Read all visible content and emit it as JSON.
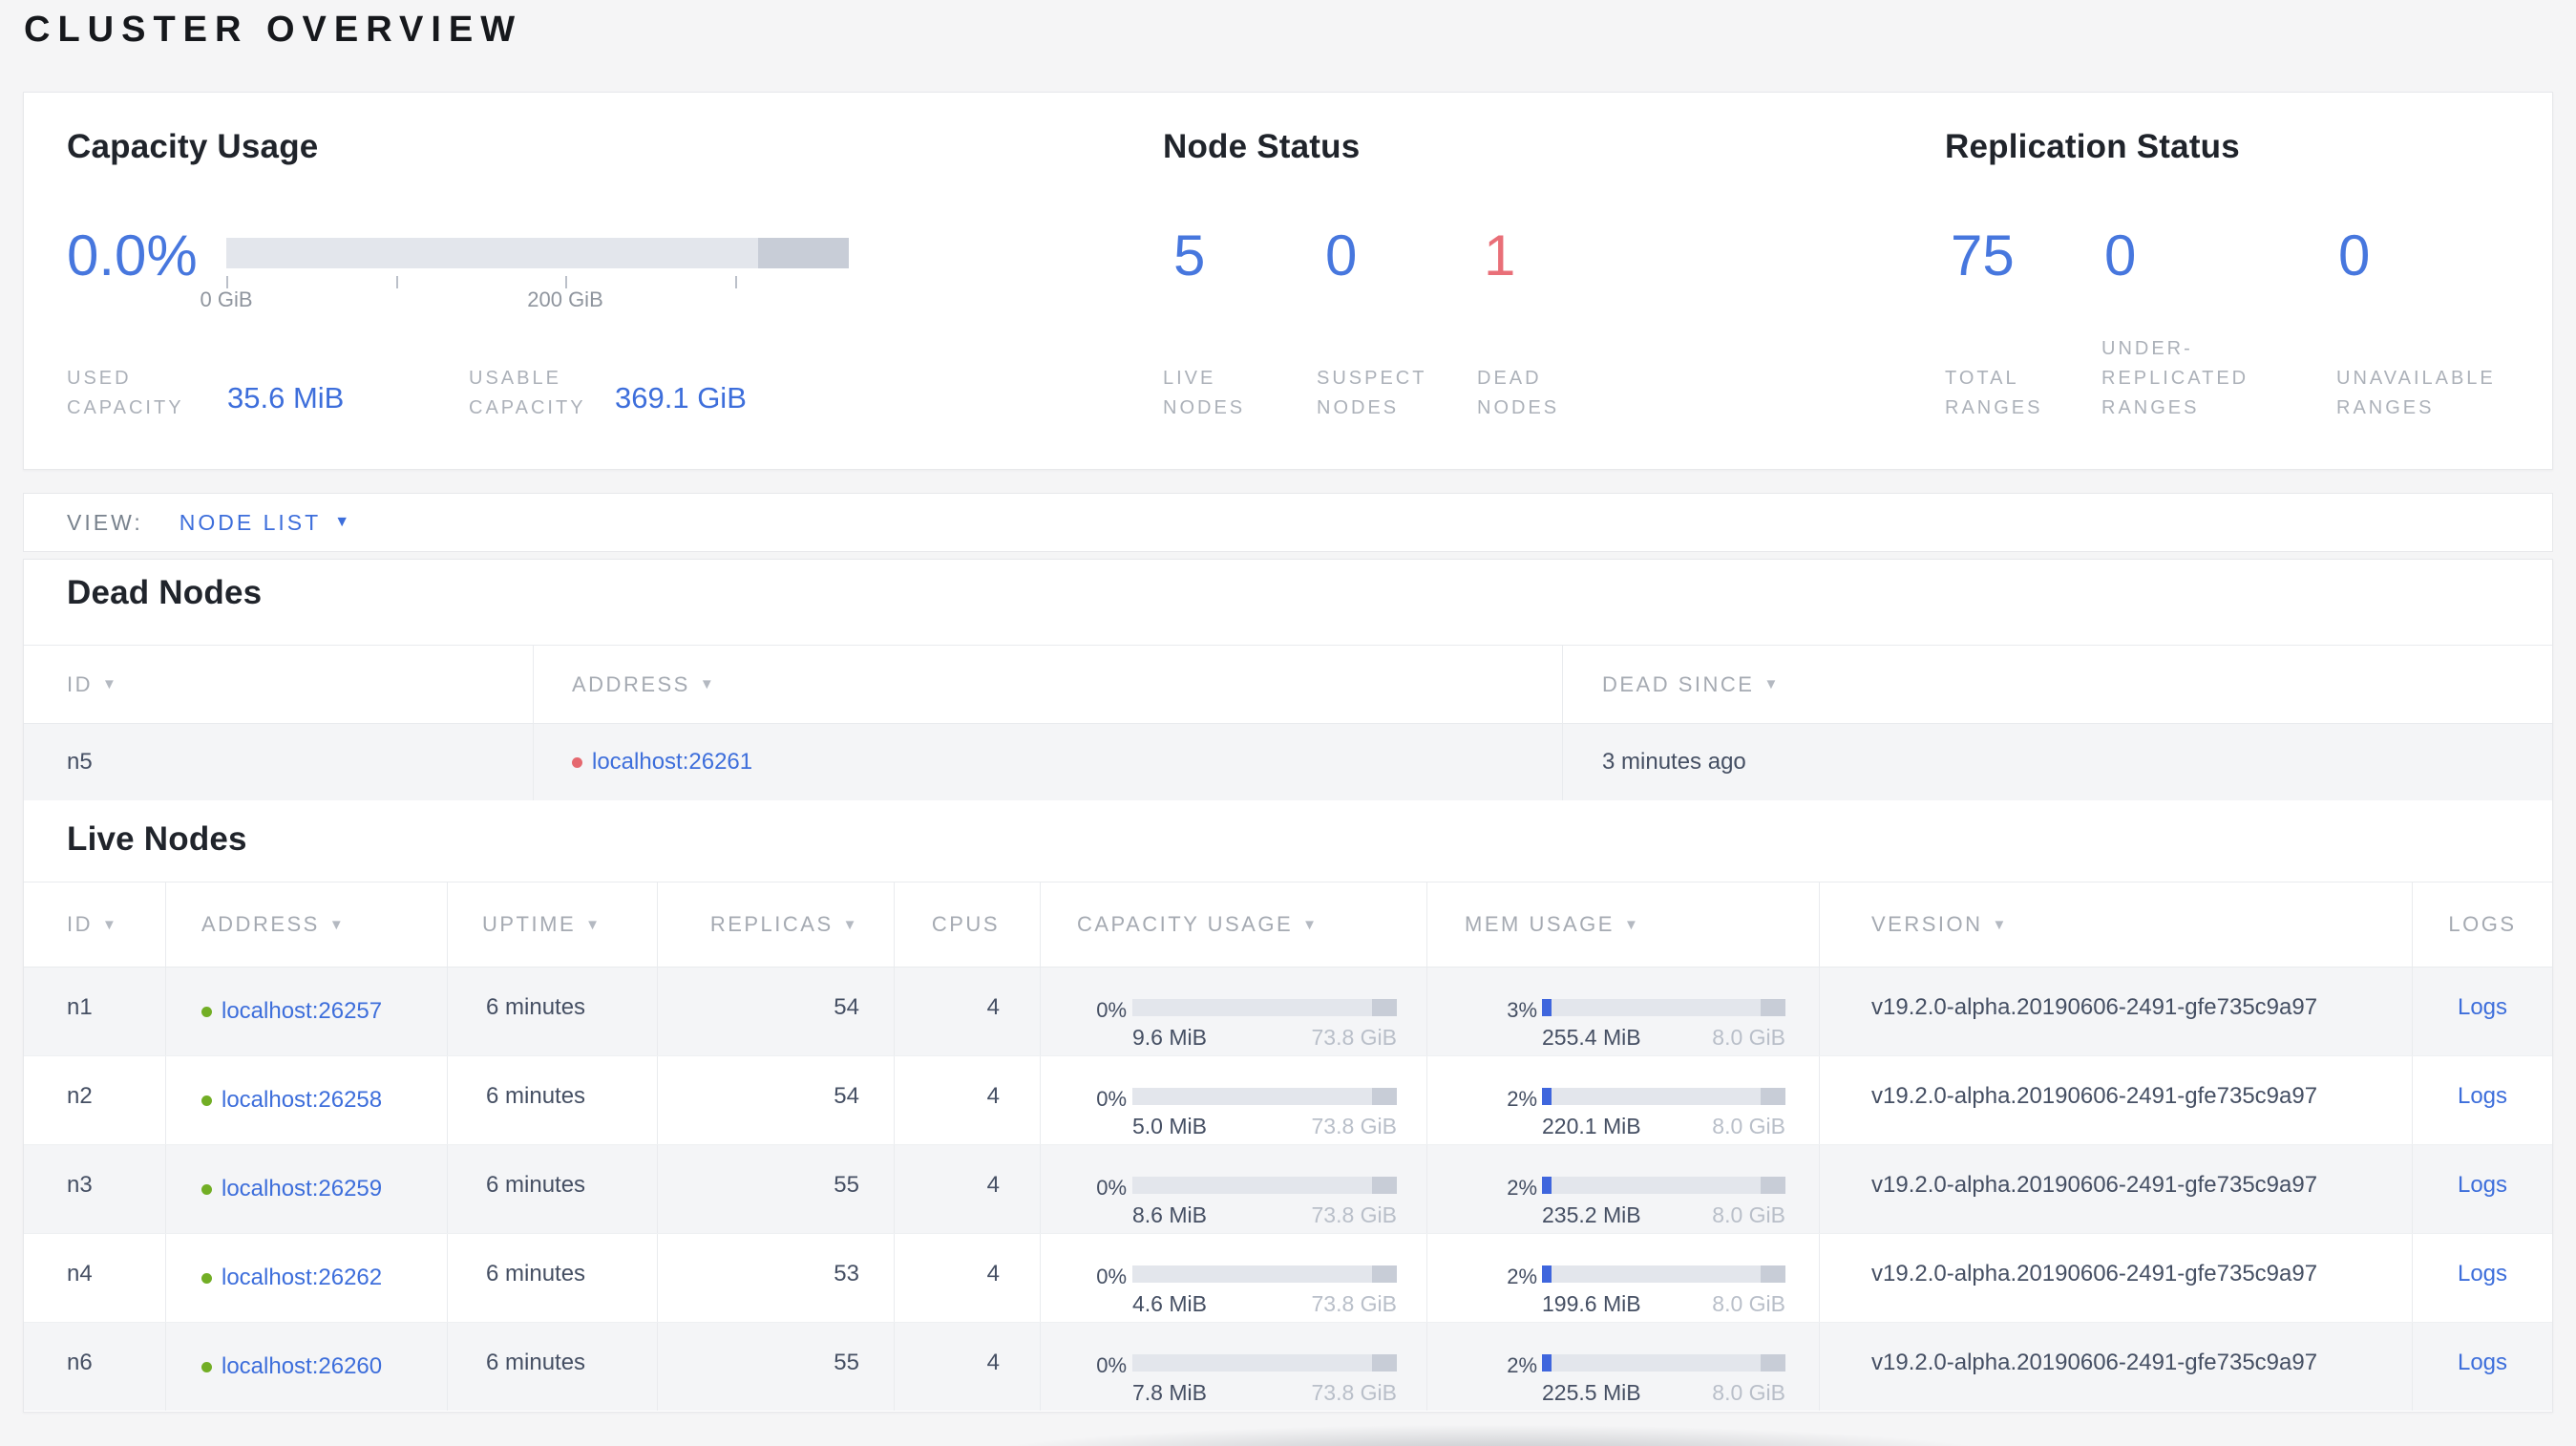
{
  "page": {
    "title": "CLUSTER OVERVIEW"
  },
  "colors": {
    "accent_blue": "#3d6edb",
    "big_number_blue": "#4777de",
    "dead_red": "#e96f78",
    "live_green": "#72ae25"
  },
  "summary": {
    "capacity": {
      "title": "Capacity Usage",
      "percent": "0.0%",
      "ticks": [
        "0 GiB",
        "200 GiB"
      ],
      "stats": [
        {
          "label": "USED\nCAPACITY",
          "value": "35.6 MiB"
        },
        {
          "label": "USABLE\nCAPACITY",
          "value": "369.1 GiB"
        }
      ]
    },
    "node_status": {
      "title": "Node Status",
      "stats": [
        {
          "value": "5",
          "label": "LIVE\nNODES",
          "color": "blue"
        },
        {
          "value": "0",
          "label": "SUSPECT\nNODES",
          "color": "blue"
        },
        {
          "value": "1",
          "label": "DEAD\nNODES",
          "color": "red"
        }
      ]
    },
    "replication": {
      "title": "Replication Status",
      "stats": [
        {
          "value": "75",
          "label": "TOTAL\nRANGES",
          "color": "blue"
        },
        {
          "value": "0",
          "label": "UNDER-\nREPLICATED\nRANGES",
          "color": "blue"
        },
        {
          "value": "0",
          "label": "UNAVAILABLE\nRANGES",
          "color": "blue"
        }
      ]
    }
  },
  "view_bar": {
    "label": "VIEW:",
    "selected": "NODE LIST"
  },
  "dead_nodes": {
    "title": "Dead Nodes",
    "headers": [
      "ID",
      "ADDRESS",
      "DEAD SINCE"
    ],
    "rows": [
      {
        "id": "n5",
        "address": "localhost:26261",
        "dead_since": "3 minutes ago"
      }
    ]
  },
  "live_nodes": {
    "title": "Live Nodes",
    "headers": [
      "ID",
      "ADDRESS",
      "UPTIME",
      "REPLICAS",
      "CPUS",
      "CAPACITY USAGE",
      "MEM USAGE",
      "VERSION",
      "LOGS"
    ],
    "rows": [
      {
        "id": "n1",
        "address": "localhost:26257",
        "uptime": "6 minutes",
        "replicas": "54",
        "cpus": "4",
        "cap_pct": "0%",
        "cap_fill": 0,
        "cap_used": "9.6 MiB",
        "cap_total": "73.8 GiB",
        "mem_pct": "3%",
        "mem_fill": 3,
        "mem_used": "255.4 MiB",
        "mem_total": "8.0 GiB",
        "version": "v19.2.0-alpha.20190606-2491-gfe735c9a97",
        "logs": "Logs"
      },
      {
        "id": "n2",
        "address": "localhost:26258",
        "uptime": "6 minutes",
        "replicas": "54",
        "cpus": "4",
        "cap_pct": "0%",
        "cap_fill": 0,
        "cap_used": "5.0 MiB",
        "cap_total": "73.8 GiB",
        "mem_pct": "2%",
        "mem_fill": 2,
        "mem_used": "220.1 MiB",
        "mem_total": "8.0 GiB",
        "version": "v19.2.0-alpha.20190606-2491-gfe735c9a97",
        "logs": "Logs"
      },
      {
        "id": "n3",
        "address": "localhost:26259",
        "uptime": "6 minutes",
        "replicas": "55",
        "cpus": "4",
        "cap_pct": "0%",
        "cap_fill": 0,
        "cap_used": "8.6 MiB",
        "cap_total": "73.8 GiB",
        "mem_pct": "2%",
        "mem_fill": 2,
        "mem_used": "235.2 MiB",
        "mem_total": "8.0 GiB",
        "version": "v19.2.0-alpha.20190606-2491-gfe735c9a97",
        "logs": "Logs"
      },
      {
        "id": "n4",
        "address": "localhost:26262",
        "uptime": "6 minutes",
        "replicas": "53",
        "cpus": "4",
        "cap_pct": "0%",
        "cap_fill": 0,
        "cap_used": "4.6 MiB",
        "cap_total": "73.8 GiB",
        "mem_pct": "2%",
        "mem_fill": 2,
        "mem_used": "199.6 MiB",
        "mem_total": "8.0 GiB",
        "version": "v19.2.0-alpha.20190606-2491-gfe735c9a97",
        "logs": "Logs"
      },
      {
        "id": "n6",
        "address": "localhost:26260",
        "uptime": "6 minutes",
        "replicas": "55",
        "cpus": "4",
        "cap_pct": "0%",
        "cap_fill": 0,
        "cap_used": "7.8 MiB",
        "cap_total": "73.8 GiB",
        "mem_pct": "2%",
        "mem_fill": 2,
        "mem_used": "225.5 MiB",
        "mem_total": "8.0 GiB",
        "version": "v19.2.0-alpha.20190606-2491-gfe735c9a97",
        "logs": "Logs"
      }
    ]
  }
}
